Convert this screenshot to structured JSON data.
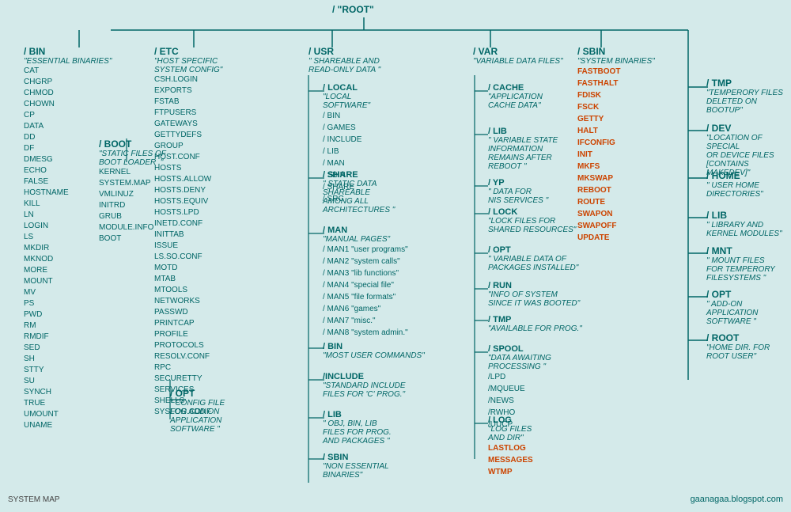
{
  "title": "/ \"ROOT\"",
  "watermark": "gaanagaa.blogspot.com",
  "system_map": "SYSTEM MAP",
  "nodes": {
    "root": {
      "title": "/ ROOT",
      "desc": "\"HOME DIR. FOR ROOT USER\""
    },
    "bin": {
      "title": "/ BIN",
      "desc": "\"ESSENTIAL BINARIES\"",
      "items": [
        "CAT",
        "CHGRP",
        "CHMOD",
        "CHOWN",
        "CP",
        "DATA",
        "DD",
        "DF",
        "DMESG",
        "ECHO",
        "FALSE",
        "HOSTNAME",
        "KILL",
        "LN",
        "LOGIN",
        "LS",
        "MKDIR",
        "MKNOD",
        "MORE",
        "MOUNT",
        "MV",
        "PS",
        "PWD",
        "RM",
        "RMDIF",
        "SED",
        "SH",
        "STTY",
        "SU",
        "SYNCH",
        "TRUE",
        "UMOUNT",
        "UNAME"
      ]
    },
    "etc": {
      "title": "/ ETC",
      "desc": "\"HOST SPECIFIC SYSTEM CONFIG\"",
      "items": [
        "CSH.LOGIN",
        "EXPORTS",
        "FSTAB",
        "FTPUSERS",
        "GATEWAYS",
        "GETTYDEFS",
        "GROUP",
        "HOST.CONF",
        "HOSTS",
        "HOSTS.ALLOW",
        "HOSTS.DENY",
        "HOSTS.EQUIV",
        "HOSTS.LPD",
        "INETD.CONF",
        "INITTAB",
        "ISSUE",
        "LS.SO.CONF",
        "MOTD",
        "MTAB",
        "MTOOLS",
        "NETWORKS",
        "PASSWD",
        "PRINTCAP",
        "PROFILE",
        "PROTOCOLS",
        "RESOLV.CONF",
        "RPC",
        "SECURETTY",
        "SERVICES",
        "SHELLS",
        "SYSLOG.CONF"
      ],
      "opt": {
        "title": "/ OPT",
        "desc": "\" CONFIG FILE FOR ADD ON APPLICATION SOFTWARE \""
      }
    },
    "usr": {
      "title": "/ USR",
      "desc": "\" SHAREABLE AND READ-ONLY DATA \"",
      "local": {
        "title": "/ LOCAL",
        "desc": "\"LOCAL SOFTWARE\"",
        "items": [
          "/BIN",
          "/GAMES",
          "/INCLUDE",
          "/LIB",
          "/MAN",
          "/SBIN",
          "/SHARE",
          "/SRC"
        ]
      },
      "share": {
        "title": "/ SHARE",
        "desc": "\" STATIC DATA SHAREABLE AMONG ALL ARCHITECTURES \""
      },
      "man": {
        "title": "/ MAN",
        "desc": "\"MANUAL PAGES\"",
        "items": [
          "/MAN1 \"user programs\"",
          "/MAN2 \"system calls\"",
          "/MAN3 \"lib functions\"",
          "/MAN4 \"special file\"",
          "/MAN5 \"file formats\"",
          "/MAN6 \"games\"",
          "/MAN7 \"misc.\"",
          "/MAN8 \"system admin.\""
        ]
      },
      "bin": {
        "title": "/ BIN",
        "desc": "\"MOST USER COMMANDS\""
      },
      "include": {
        "title": "/INCLUDE",
        "desc": "\"STANDARD INCLUDE FILES FOR 'C' PROG.\""
      },
      "lib": {
        "title": "/ LIB",
        "desc": "\" OBJ, BIN, LIB FILES FOR PROG. AND PACKAGES \""
      },
      "sbin": {
        "title": "/ SBIN",
        "desc": "\"NON ESSENTIAL BINARIES\""
      }
    },
    "var": {
      "title": "/ VAR",
      "desc": "\"VARIABLE DATA FILES\"",
      "cache": {
        "title": "/ CACHE",
        "desc": "\"APPLICATION CACHE DATA\""
      },
      "lib": {
        "title": "/ LIB",
        "desc": "\" VARIABLE STATE INFORMATION REMAINS AFTER REBOOT \""
      },
      "yp": {
        "title": "/ YP",
        "desc": "\" DATA FOR NIS SERVICES \""
      },
      "lock": {
        "title": "/ LOCK",
        "desc": "\"LOCK FILES FOR SHARED RESOURCES\""
      },
      "opt": {
        "title": "/ OPT",
        "desc": "\" VARIABLE DATA OF PACKAGES INSTALLED\""
      },
      "run": {
        "title": "/ RUN",
        "desc": "\"INFO OF SYSTEM SINCE IT WAS BOOTED\""
      },
      "tmp": {
        "title": "/ TMP",
        "desc": "\"AVAILABLE FOR PROG.\""
      },
      "spool": {
        "title": "/ SPOOL",
        "desc": "\"DATA AWAITING PROCESSING \"",
        "items": [
          "/LPD",
          "/MQUEUE",
          "/NEWS",
          "/RWHO",
          "/UUCP"
        ]
      },
      "log": {
        "title": "/ LOG",
        "desc": "\"LOG FILES AND DIR\"",
        "items": [
          "LASTLOG",
          "MESSAGES",
          "WTMP"
        ]
      }
    },
    "sbin": {
      "title": "/ SBIN",
      "desc": "\"SYSTEM BINARIES\"",
      "items": [
        "FASTBOOT",
        "FASTHALT",
        "FDISK",
        "FSCK",
        "GETTY",
        "HALT",
        "IFCONFIG",
        "INIT",
        "MKFS",
        "MKSWAP",
        "REBOOT",
        "ROUTE",
        "SWAPON",
        "SWAPOFF",
        "UPDATE"
      ]
    },
    "boot": {
      "title": "/ BOOT",
      "desc": "\"STATIC FILES OF BOOT LOADER .\"",
      "items": [
        "KERNEL",
        "SYSTEM.MAP",
        "VMLINUZ",
        "INITRD",
        "GRUB",
        "MODULE.INFO",
        "BOOT"
      ]
    },
    "tmp": {
      "title": "/ TMP",
      "desc": "\"TEMPERORY FILES DELETED ON BOOTUP\""
    },
    "dev": {
      "title": "/ DEV",
      "desc": "\"LOCATION OF SPECIAL OR DEVICE FILES [CONTAINS MAKEDEV]\""
    },
    "home": {
      "title": "/ HOME",
      "desc": "\" USER HOME DIRECTORIES\""
    },
    "lib": {
      "title": "/ LIB",
      "desc": "\"  LIBRARY AND KERNEL MODULES\""
    },
    "mnt": {
      "title": "/ MNT",
      "desc": "\"  MOUNT FILES FOR TEMPERORY FILESYSTEMS \""
    },
    "opt": {
      "title": "/ OPT",
      "desc": "\" ADD-ON APPLICATION SOFTWARE \""
    }
  }
}
